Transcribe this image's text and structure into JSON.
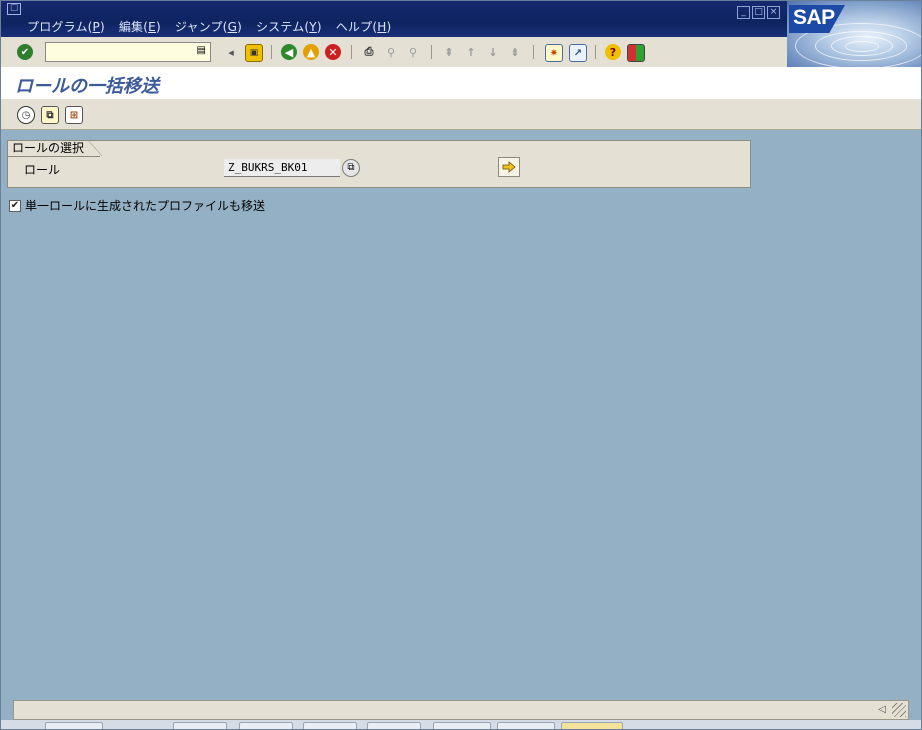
{
  "menubar": {
    "items": [
      {
        "label": "プログラム(",
        "key": "P",
        "suffix": ")"
      },
      {
        "label": "編集(",
        "key": "E",
        "suffix": ")"
      },
      {
        "label": "ジャンプ(",
        "key": "G",
        "suffix": ")"
      },
      {
        "label": "システム(",
        "key": "Y",
        "suffix": ")"
      },
      {
        "label": "ヘルプ(",
        "key": "H",
        "suffix": ")"
      }
    ],
    "logo_text": "SAP"
  },
  "toolbar": {
    "command_field_value": ""
  },
  "screen": {
    "title": "ロールの一括移送"
  },
  "selection": {
    "group_title": "ロールの選択",
    "role_label": "ロール",
    "role_value": "Z_BUKRS_BK01"
  },
  "options": {
    "transport_profiles_label": "単一ロールに生成されたプロファイルも移送",
    "transport_profiles_checked": true
  },
  "colors": {
    "menubar": "#0d2460",
    "toolbar": "#e4e0d4",
    "background": "#94b0c4",
    "title_text": "#3c5b98"
  }
}
